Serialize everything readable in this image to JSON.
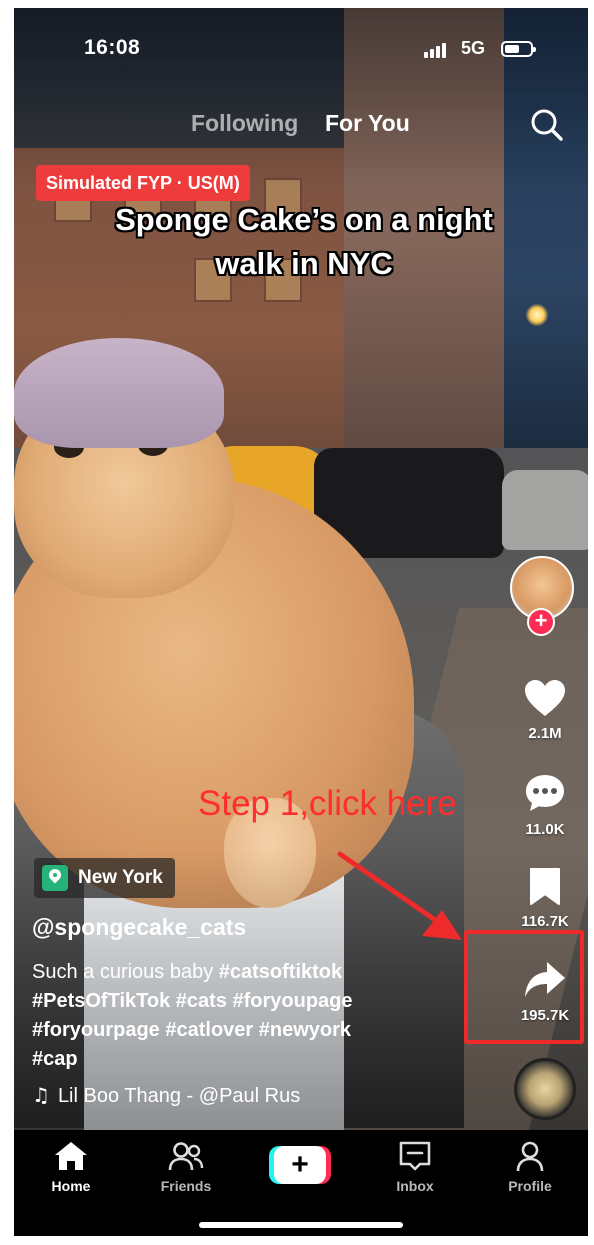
{
  "status_bar": {
    "time": "16:08",
    "network": "5G"
  },
  "feed_tabs": {
    "following": "Following",
    "for_you": "For You"
  },
  "video": {
    "region_badge": "Simulated FYP · US(M)",
    "overlay_title": "Sponge Cake’s on a night walk in NYC"
  },
  "actions": {
    "like_count": "2.1M",
    "comment_count": "11.0K",
    "bookmark_count": "116.7K",
    "share_count": "195.7K",
    "follow_symbol": "+"
  },
  "annotation": {
    "step_text": "Step 1,click here",
    "color": "#ff2d2d"
  },
  "post": {
    "location": "New York",
    "author": "@spongecake_cats",
    "caption_text": "Such a curious baby ",
    "hashtags": [
      "#catsoftiktok",
      "#PetsOfTikTok",
      "#cats",
      "#foryoupage",
      "#foryourpage",
      "#catlover",
      "#newyork",
      "#cap"
    ],
    "sound_icon": "♫",
    "sound": "Lil Boo Thang - @Paul Rus"
  },
  "tabbar": {
    "home": "Home",
    "friends": "Friends",
    "create_symbol": "+",
    "inbox": "Inbox",
    "profile": "Profile"
  },
  "icons": [
    "search-icon",
    "heart-icon",
    "comment-icon",
    "bookmark-icon",
    "share-icon",
    "home-icon",
    "friends-icon",
    "inbox-icon",
    "profile-icon",
    "location-pin-icon",
    "music-note-icon"
  ],
  "colors": {
    "accent": "#fe2c55",
    "badge": "#ee3b3b",
    "annotation_red": "#ee2a2a",
    "location_green": "#25b37a"
  }
}
